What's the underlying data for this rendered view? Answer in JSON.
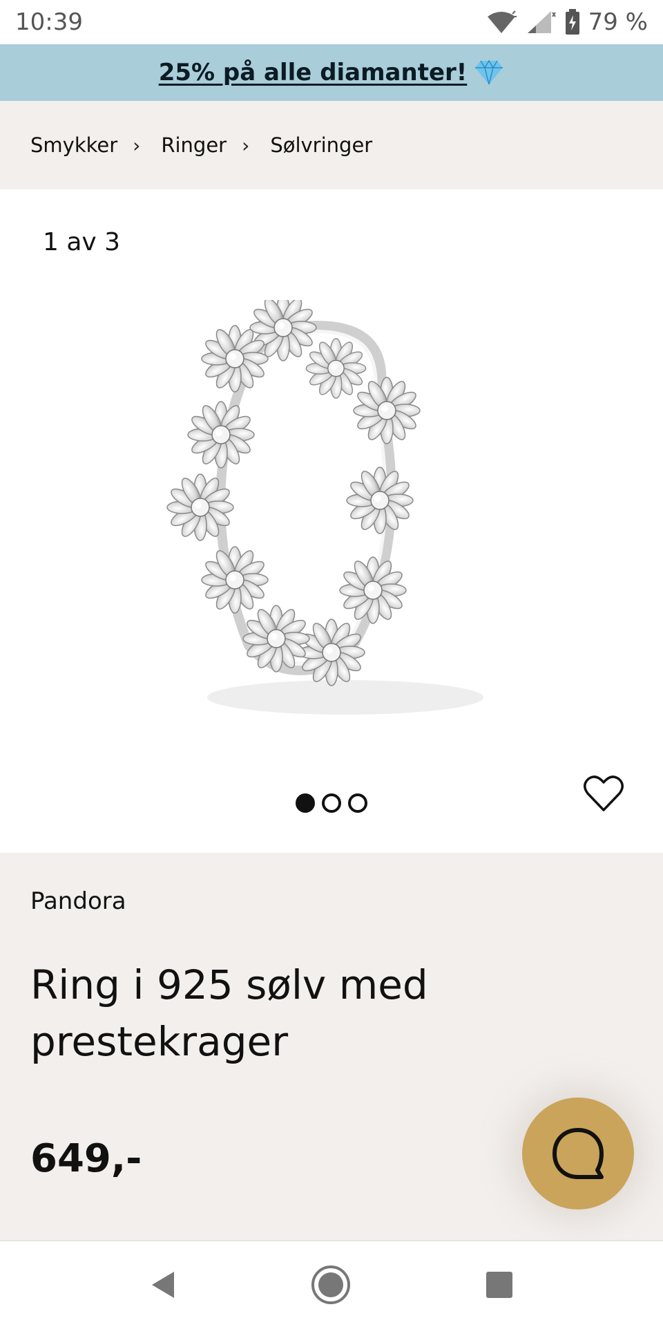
{
  "status": {
    "time": "10:39",
    "battery": "79 %",
    "icons": [
      "wifi-icon",
      "signal-icon",
      "battery-icon"
    ]
  },
  "promo": {
    "text": "25% på alle diamanter!",
    "icon": "diamond-icon"
  },
  "breadcrumb": {
    "items": [
      "Smykker",
      "Ringer",
      "Sølvringer"
    ],
    "separator_icon": "chevron-right-icon"
  },
  "gallery": {
    "counter": "1 av 3",
    "current": 1,
    "total": 3,
    "favorite_icon": "heart-icon"
  },
  "product": {
    "brand": "Pandora",
    "title": "Ring i 925 sølv med prestekrager",
    "price": "649,-"
  },
  "chat": {
    "icon": "chat-bubble-icon",
    "color": "#c9a45a"
  },
  "navbar": {
    "icons": [
      "back-icon",
      "home-icon",
      "recents-icon"
    ]
  },
  "colors": {
    "promo_bg": "#a9cdd9",
    "section_bg": "#f2efec"
  }
}
